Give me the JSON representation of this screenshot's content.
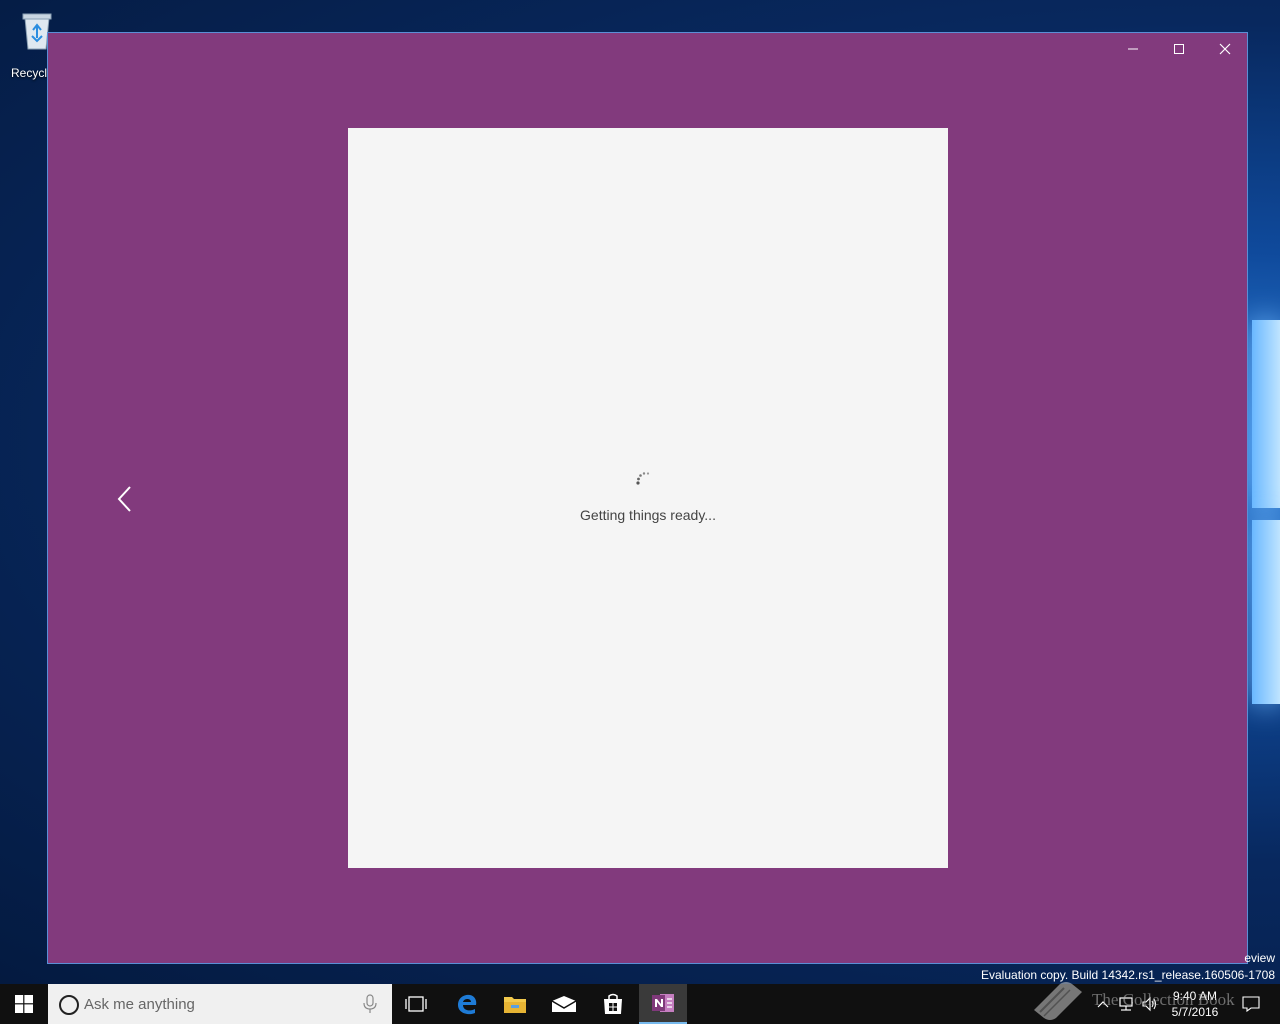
{
  "desktop": {
    "recycle_bin_label": "Recycle"
  },
  "app": {
    "window_buttons": [
      "minimize",
      "maximize",
      "close"
    ],
    "loading_text": "Getting things ready...",
    "colors": {
      "background": "#823a7d",
      "page": "#f5f5f5"
    }
  },
  "system": {
    "eval_line1": "eview",
    "eval_line2": "Evaluation copy. Build 14342.rs1_release.160506-1708"
  },
  "taskbar": {
    "search_placeholder": "Ask me anything",
    "apps": [
      "task-view-icon",
      "edge-icon",
      "file-explorer-icon",
      "mail-icon",
      "store-icon",
      "onenote-icon"
    ],
    "active_app": "OneNote",
    "clock_time": "9:40 AM",
    "clock_date": "5/7/2016"
  },
  "watermark": {
    "text": "The Collection Book"
  }
}
